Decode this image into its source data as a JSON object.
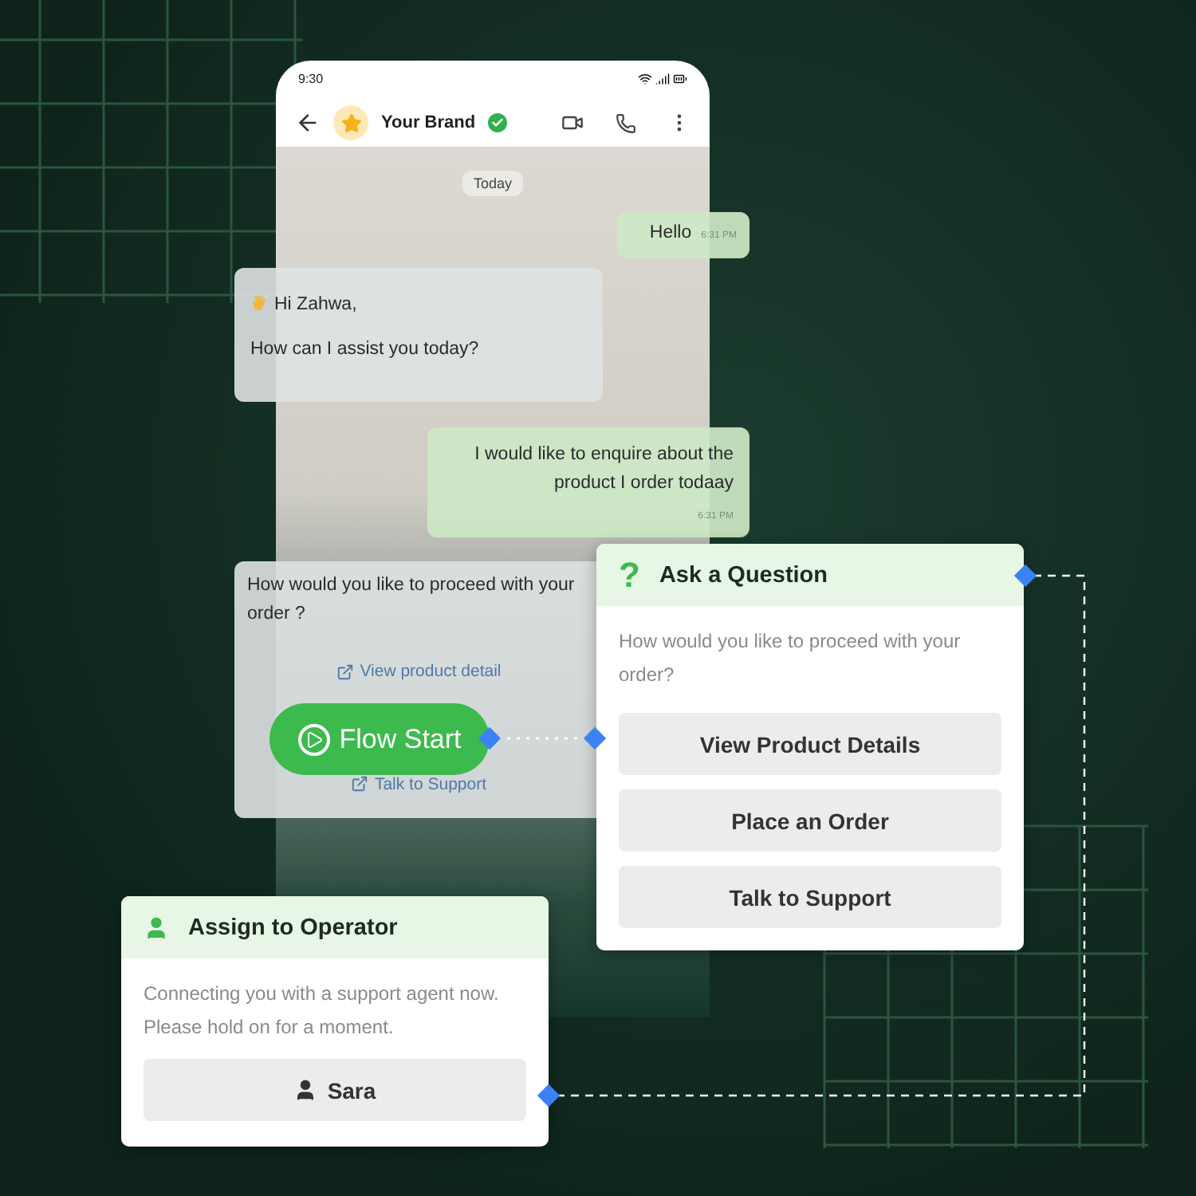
{
  "phone": {
    "status_time": "9:30",
    "contact": {
      "name": "Your Brand",
      "verified": true
    },
    "date_chip": "Today",
    "messages": [
      {
        "kind": "outgoing",
        "lines": [
          "Hello"
        ],
        "time": "6:31 PM"
      },
      {
        "kind": "incoming",
        "lines": [
          "Hi Zahwa,",
          "How can I assist you today?"
        ],
        "wave": true
      },
      {
        "kind": "outgoing",
        "lines": [
          "I would like to enquire about the product I order todaay"
        ],
        "time": "6:31 PM"
      },
      {
        "kind": "menu",
        "lines": [
          "How would you like to proceed with your order ?"
        ],
        "links": [
          "View product detail",
          "Talk to Support"
        ]
      }
    ]
  },
  "flow_start": {
    "label": "Flow Start"
  },
  "question_card": {
    "icon": "?",
    "title": "Ask a Question",
    "prompt": "How would you like to proceed with your order?",
    "options": [
      "View Product Details",
      "Place an Order",
      "Talk to Support"
    ]
  },
  "operator_card": {
    "title": "Assign to Operator",
    "message": "Connecting you with a support agent now. Please hold on for a moment.",
    "agent": "Sara"
  }
}
